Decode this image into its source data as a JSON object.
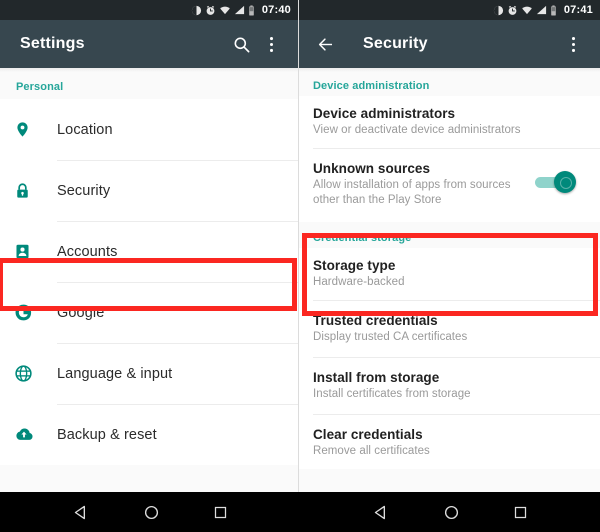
{
  "left": {
    "statusbar": {
      "time": "07:40",
      "icons": [
        "dnd-icon",
        "alarm-icon",
        "wifi-icon",
        "signal-icon",
        "battery-icon"
      ]
    },
    "appbar": {
      "title": "Settings",
      "search_icon": "search-icon",
      "overflow_icon": "overflow-menu-icon"
    },
    "section_header": "Personal",
    "items": [
      {
        "label": "Location",
        "icon": "location-pin-icon"
      },
      {
        "label": "Security",
        "icon": "lock-icon"
      },
      {
        "label": "Accounts",
        "icon": "account-badge-icon"
      },
      {
        "label": "Google",
        "icon": "google-g-icon"
      },
      {
        "label": "Language & input",
        "icon": "globe-icon"
      },
      {
        "label": "Backup & reset",
        "icon": "cloud-upload-icon"
      }
    ]
  },
  "right": {
    "statusbar": {
      "time": "07:41",
      "icons": [
        "dnd-icon",
        "alarm-icon",
        "wifi-icon",
        "signal-icon",
        "battery-icon"
      ]
    },
    "appbar": {
      "title": "Security",
      "back_icon": "back-arrow-icon",
      "overflow_icon": "overflow-menu-icon"
    },
    "sections": [
      {
        "header": "Device administration",
        "items": [
          {
            "title": "Device administrators",
            "subtitle": "View or deactivate device administrators",
            "toggle": null
          },
          {
            "title": "Unknown sources",
            "subtitle": "Allow installation of apps from sources other than the Play Store",
            "toggle": "on"
          }
        ]
      },
      {
        "header": "Credential storage",
        "items": [
          {
            "title": "Storage type",
            "subtitle": "Hardware-backed",
            "toggle": null
          },
          {
            "title": "Trusted credentials",
            "subtitle": "Display trusted CA certificates",
            "toggle": null
          },
          {
            "title": "Install from storage",
            "subtitle": "Install certificates from storage",
            "toggle": null
          },
          {
            "title": "Clear credentials",
            "subtitle": "Remove all certificates",
            "toggle": null
          }
        ]
      }
    ]
  },
  "navbar": {
    "back_label": "back-triangle-icon",
    "home_label": "home-circle-icon",
    "recents_label": "recents-square-icon"
  },
  "colors": {
    "accent_teal": "#26a69a",
    "appbar": "#37474f",
    "statusbar": "#22282b",
    "highlight_red": "#fb2721",
    "toggle_on": "#00897b"
  }
}
